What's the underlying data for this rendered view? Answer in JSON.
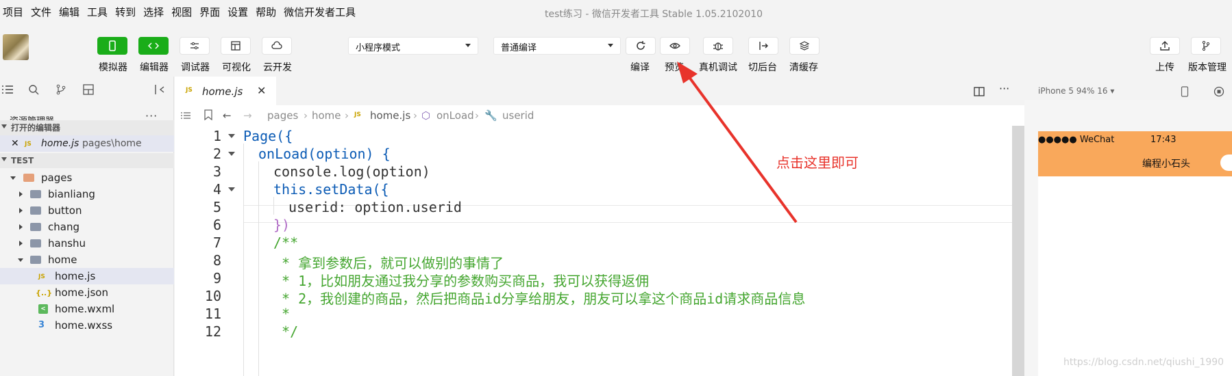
{
  "menu": {
    "items": [
      "项目",
      "文件",
      "编辑",
      "工具",
      "转到",
      "选择",
      "视图",
      "界面",
      "设置",
      "帮助",
      "微信开发者工具"
    ],
    "window_title": "test练习 - 微信开发者工具 Stable 1.05.2102010"
  },
  "toolbar": {
    "simulator": "模拟器",
    "editor": "编辑器",
    "debugger": "调试器",
    "visual": "可视化",
    "cloud": "云开发",
    "mode_select": "小程序模式",
    "compile_select": "普通编译",
    "compile": "编译",
    "preview": "预览",
    "device_debug": "真机调试",
    "background": "切后台",
    "clear_cache": "清缓存",
    "upload": "上传",
    "version": "版本管理",
    "accent": "#1aad19"
  },
  "explorer": {
    "title": "资源管理器",
    "more": "···",
    "open_editors": "打开的编辑器",
    "open_file": {
      "name": "home.js",
      "path": "pages\\home"
    },
    "project": "TEST",
    "tree": {
      "pages": "pages",
      "bianliang": "bianliang",
      "button": "button",
      "chang": "chang",
      "hanshu": "hanshu",
      "home": "home",
      "home_js": "home.js",
      "home_json": "home.json",
      "home_wxml": "home.wxml",
      "home_wxss": "home.wxss"
    }
  },
  "editor": {
    "tab": "home.js",
    "tab_close": "✕",
    "breadcrumb": [
      "pages",
      "home",
      "home.js",
      "onLoad",
      "userid"
    ],
    "line_numbers": [
      "1",
      "2",
      "3",
      "4",
      "5",
      "6",
      "7",
      "8",
      "9",
      "10",
      "11",
      "12"
    ],
    "code": {
      "l1": "Page({",
      "l2": "onLoad(option) {",
      "l3": "console.log(option)",
      "l4": "this.setData({",
      "l5": "userid: option.userid",
      "l6": "})",
      "l7": "/**",
      "l8": " * 拿到参数后，就可以做别的事情了",
      "l9": " * 1，比如朋友通过我分享的参数购买商品，我可以获得返佣",
      "l10": " * 2，我创建的商品，然后把商品id分享给朋友，朋友可以拿这个商品id请求商品信息",
      "l11": " *",
      "l12": " */"
    }
  },
  "simulator": {
    "device": "iPhone 5 94% 16 ▾",
    "carrier": "●●●●● WeChat",
    "time": "17:43",
    "nav_title": "编程小石头",
    "nav_color": "#f9a85b"
  },
  "annotation": {
    "text": "点击这里即可",
    "color": "#e8332b"
  },
  "watermark": "https://blog.csdn.net/qiushi_1990"
}
